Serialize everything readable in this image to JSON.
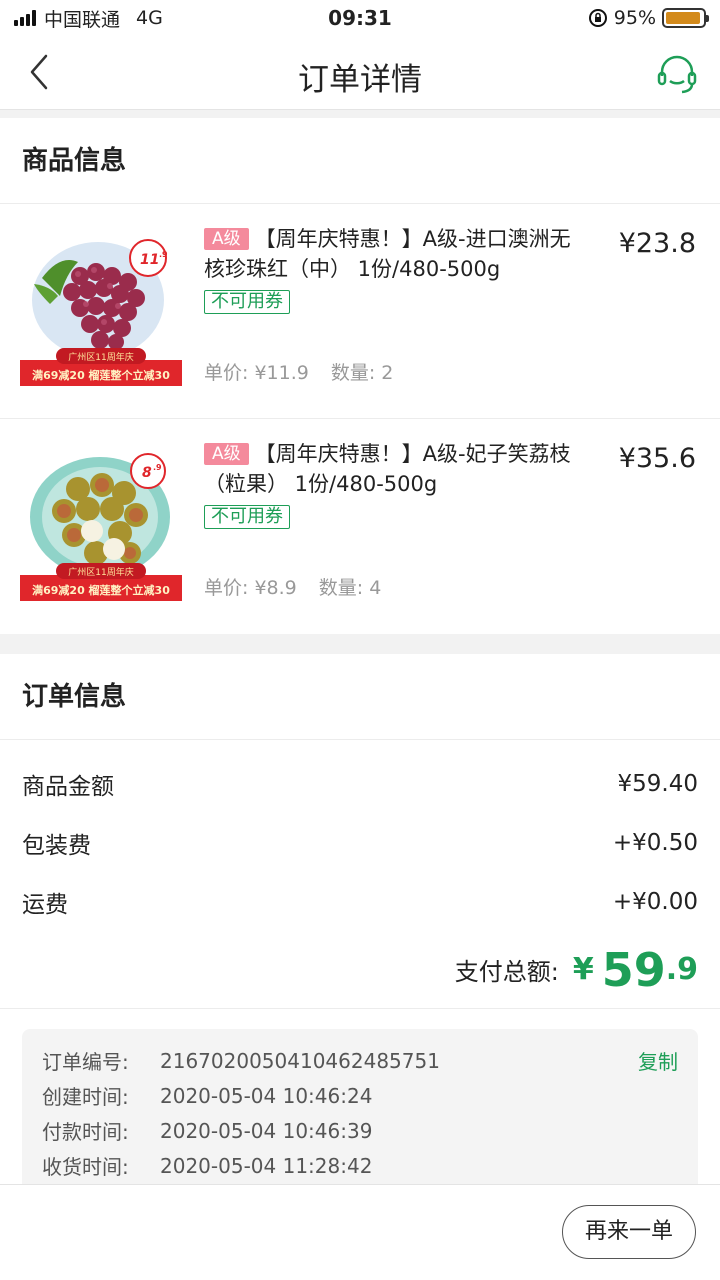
{
  "status_bar": {
    "carrier": "中国联通",
    "network": "4G",
    "time": "09:31",
    "battery": "95%",
    "battery_level": 0.95,
    "battery_color": "#d38a1b"
  },
  "header": {
    "title": "订单详情",
    "back_icon": "chevron-left-icon",
    "service_icon": "headset-icon"
  },
  "goods": {
    "title": "商品信息",
    "items": [
      {
        "grade": "A级",
        "name": "【周年庆特惠！】A级-进口澳洲无核珍珠红（中） 1份/480-500g",
        "coupon": "不可用券",
        "price": "¥23.8",
        "unit_price": "单价: ¥11.9",
        "quantity": "数量: 2",
        "image": {
          "price_tag_main": "11",
          "price_tag_dec": ".9",
          "banner_top": "广州区11周年庆",
          "banner_bottom": "满69减20 榴莲整个立减30"
        }
      },
      {
        "grade": "A级",
        "name": "【周年庆特惠！】A级-妃子笑荔枝（粒果） 1份/480-500g",
        "coupon": "不可用券",
        "price": "¥35.6",
        "unit_price": "单价: ¥8.9",
        "quantity": "数量: 4",
        "image": {
          "price_tag_main": "8",
          "price_tag_dec": ".9",
          "banner_top": "广州区11周年庆",
          "banner_bottom": "满69减20 榴莲整个立减30"
        }
      }
    ]
  },
  "order": {
    "title": "订单信息",
    "rows": [
      {
        "label": "商品金额",
        "value": "¥59.40"
      },
      {
        "label": "包装费",
        "value": "+¥0.50"
      },
      {
        "label": "运费",
        "value": "+¥0.00"
      }
    ],
    "total_label": "支付总额:",
    "total_currency": "¥",
    "total_int": "59",
    "total_dec": ".9",
    "meta": [
      {
        "label": "订单编号:",
        "value": "21670200504104624857​51",
        "action": "复制"
      },
      {
        "label": "创建时间:",
        "value": "2020-05-04 10:46:24"
      },
      {
        "label": "付款时间:",
        "value": "2020-05-04 10:46:39"
      },
      {
        "label": "收货时间:",
        "value": "2020-05-04 11:28:42"
      }
    ]
  },
  "bottom": {
    "again_label": "再来一单"
  },
  "colors": {
    "accent": "#1e9e57",
    "grade_tag": "#f48a9c",
    "promo_red": "#e0262b"
  }
}
